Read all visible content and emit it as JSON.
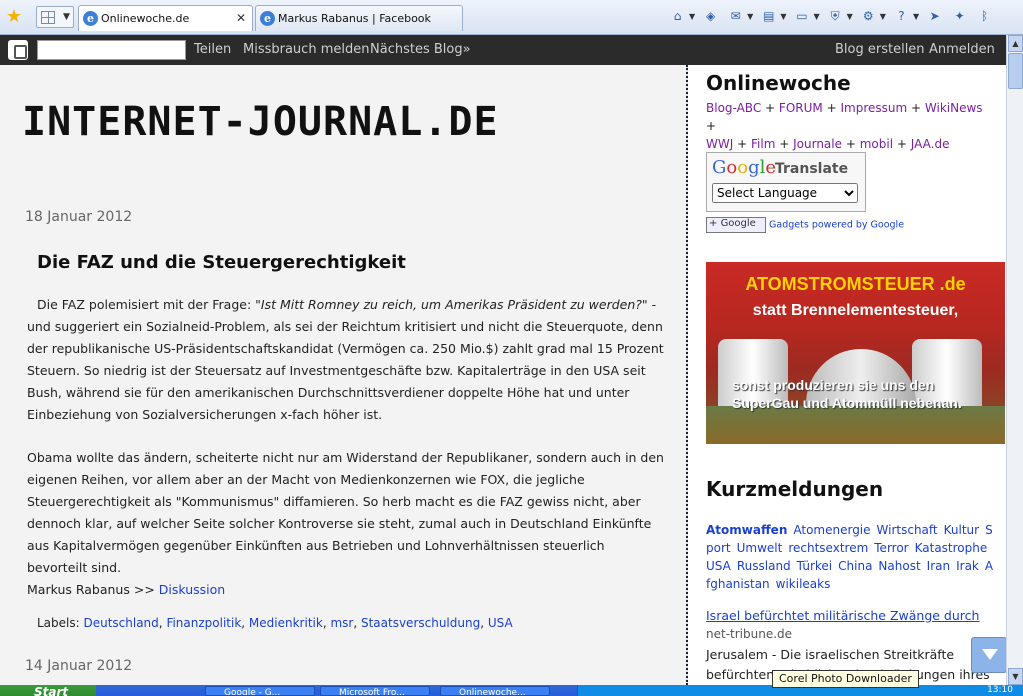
{
  "browser": {
    "tabs": [
      {
        "label": "Onlinewoche.de",
        "active": true
      },
      {
        "label": "Markus Rabanus | Facebook",
        "active": false
      }
    ],
    "toolbar_icons": [
      "home-icon",
      "feeds-icon",
      "mail-icon",
      "print-icon",
      "page-icon",
      "safety-icon",
      "tools-icon",
      "help-icon",
      "research-icon",
      "messenger-icon",
      "bluetooth-icon"
    ]
  },
  "navbar": {
    "search_value": "",
    "share": "Teilen",
    "report": "Missbrauch melden",
    "next_blog": "Nächstes Blog»",
    "create_blog": "Blog erstellen",
    "login": "Anmelden"
  },
  "blog": {
    "title": "INTERNET-JOURNAL.DE",
    "post": {
      "date": "18 Januar 2012",
      "title": "Die FAZ und die Steuergerechtigkeit",
      "p1_intro": "Die FAZ polemisiert mit der Frage: ",
      "p1_quote": "\"Ist Mitt Romney zu reich, um Amerikas Präsident zu werden?\"",
      "p1_rest": " - und suggeriert ein Sozialneid-Problem, als sei der Reichtum kritisiert und nicht die Steuerquote, denn der republikanische US-Präsidentschaftskandidat (Vermögen ca. 250 Mio.$) zahlt grad mal 15 Prozent Steuern. So niedrig ist der Steuersatz auf Investmentgeschäfte bzw. Kapitalerträge in den USA seit Bush, während sie für den amerikanischen Durchschnittsverdiener doppelte Höhe hat und unter Einbeziehung von Sozialversicherungen x-fach höher ist.",
      "p2": "Obama wollte das ändern, scheiterte nicht nur am Widerstand der Republikaner, sondern auch in den eigenen Reihen, vor allem aber an der Macht von Medienkonzernen wie FOX, die jegliche Steuergerechtigkeit als \"Kommunismus\" diffamieren. So herb macht es die FAZ gewiss nicht, aber dennoch klar, auf welcher Seite solcher Kontroverse sie steht, zumal auch in Deutschland Einkünfte aus Kapitalvermögen gegenüber Einkünften aus Betrieben und Lohnverhältnissen steuerlich bevorteilt sind.",
      "author": "Markus Rabanus >> ",
      "discussion": "Diskussion",
      "labels_prefix": "Labels: ",
      "labels": [
        "Deutschland",
        "Finanzpolitik",
        "Medienkritik",
        "msr",
        "Staatsverschuldung",
        "USA"
      ]
    },
    "next_date": "14 Januar 2012"
  },
  "sidebar": {
    "title": "Onlinewoche",
    "links": [
      "Blog-ABC",
      "FORUM",
      "Impressum",
      "WikiNews",
      "WWJ",
      "Film",
      "Journale",
      "mobil",
      "JAA.de"
    ],
    "separator": "+",
    "translate": {
      "logo": "Google",
      "label": "Translate",
      "select": "Select Language"
    },
    "gadget_button": "Google",
    "gadget_text": "Gadgets powered by Google",
    "ad": {
      "line1": "ATOMSTROMSTEUER .de",
      "line2": "statt Brennelementesteuer,",
      "line3": "sonst produzieren sie uns den SuperGau und Atommüll nebenan."
    },
    "news_title": "Kurzmeldungen",
    "tags": [
      "Atomwaffen",
      "Atomenergie",
      "Wirtschaft",
      "Kultur",
      "Sport",
      "Umwelt",
      "rechtsextrem",
      "Terror",
      "Katastrophe",
      "USA",
      "Russland",
      "Türkei",
      "China",
      "Nahost",
      "Iran",
      "Irak",
      "Afghanistan",
      "wikileaks"
    ],
    "news_link": "Israel befürchtet militärische Zwänge durch",
    "news_source": "net-tribune.de",
    "news_text": "Jerusalem - Die israelischen Streitkräfte befürchten erhebliche Einschränkungen ihres"
  },
  "taskbar": {
    "start": "Start",
    "tasks": [
      "Google - G...",
      "Microsoft Fro...",
      "Onlinewoche..."
    ],
    "clock": "13:10"
  },
  "tooltip": "Corel Photo Downloader"
}
